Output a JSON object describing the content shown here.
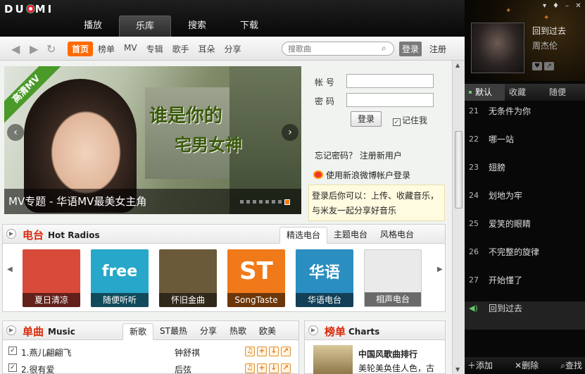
{
  "logo": "DU MI",
  "main_tabs": [
    {
      "label": "播放"
    },
    {
      "label": "乐库",
      "active": true
    },
    {
      "label": "搜索"
    },
    {
      "label": "下载"
    }
  ],
  "nav": {
    "back_icon": "arrow-left-icon",
    "forward_icon": "arrow-right-icon",
    "refresh_icon": "refresh-icon",
    "links": [
      {
        "label": "首页",
        "active": true
      },
      {
        "label": "榜单"
      },
      {
        "label": "MV"
      },
      {
        "label": "专辑"
      },
      {
        "label": "歌手"
      },
      {
        "label": "耳朵"
      },
      {
        "label": "分享"
      }
    ],
    "search_placeholder": "搜歌曲",
    "login": "登录",
    "register": "注册"
  },
  "banner": {
    "ribbon": "高清MV",
    "headline1": "谁是你的",
    "headline2": "宅男女神",
    "caption": "MV专题 - 华语MV最美女主角",
    "slide_index": 8,
    "slide_count": 8
  },
  "login_panel": {
    "account_label": "帐 号",
    "password_label": "密 码",
    "login_button": "登录",
    "remember": "记住我",
    "remember_checked": true,
    "forgot": "忘记密码？",
    "register_new": "注册新用户",
    "weibo": "使用新浪微博帐户登录",
    "hint_line1": "登录后你可以：上传、收藏音乐，",
    "hint_line2": "与米友一起分享好音乐"
  },
  "radio": {
    "title": "电台",
    "subtitle": "Hot Radios",
    "tabs": [
      {
        "label": "精选电台",
        "active": true
      },
      {
        "label": "主题电台"
      },
      {
        "label": "风格电台"
      }
    ],
    "items": [
      {
        "label": "夏日清凉",
        "art": "",
        "color": "#d84a3a"
      },
      {
        "label": "随便听听",
        "art": "free",
        "color": "#27a7c9"
      },
      {
        "label": "怀旧金曲",
        "art": "",
        "color": "#6b5a3a"
      },
      {
        "label": "SongTaste",
        "art": "ST",
        "color": "#f07a1a"
      },
      {
        "label": "华语电台",
        "art": "华语",
        "color": "#2a8ec0"
      },
      {
        "label": "相声电台",
        "art": "",
        "color": "#eaeaea"
      }
    ]
  },
  "single": {
    "title": "单曲",
    "subtitle": "Music",
    "tabs": [
      {
        "label": "新歌",
        "active": true
      },
      {
        "label": "ST最热"
      },
      {
        "label": "分享"
      },
      {
        "label": "热歌"
      },
      {
        "label": "欧美"
      }
    ],
    "songs": [
      {
        "title": "1.燕儿翩翩飞",
        "artist": "钟舒祺",
        "checked": true
      },
      {
        "title": "2.很有爱",
        "artist": "后弦",
        "checked": true
      }
    ]
  },
  "charts": {
    "title": "榜单",
    "subtitle": "Charts",
    "item_title": "中国风歌曲排行",
    "item_desc": "美轮美奂佳人色，古"
  },
  "player": {
    "now_title": "回到过去",
    "now_artist": "周杰伦",
    "tabs": [
      {
        "label": "默认",
        "active": true
      },
      {
        "label": "收藏"
      },
      {
        "label": "随便"
      }
    ],
    "playlist": [
      {
        "num": "21",
        "title": "无条件为你"
      },
      {
        "num": "22",
        "title": "哪一站"
      },
      {
        "num": "23",
        "title": "翅膀"
      },
      {
        "num": "24",
        "title": "划地为牢"
      },
      {
        "num": "25",
        "title": "爱笑的眼睛"
      },
      {
        "num": "26",
        "title": "不完整的旋律"
      },
      {
        "num": "27",
        "title": "开始懂了"
      },
      {
        "num": "",
        "title": "回到过去",
        "playing": true
      }
    ],
    "footer": {
      "add": "添加",
      "delete": "删除",
      "find": "查找"
    }
  }
}
